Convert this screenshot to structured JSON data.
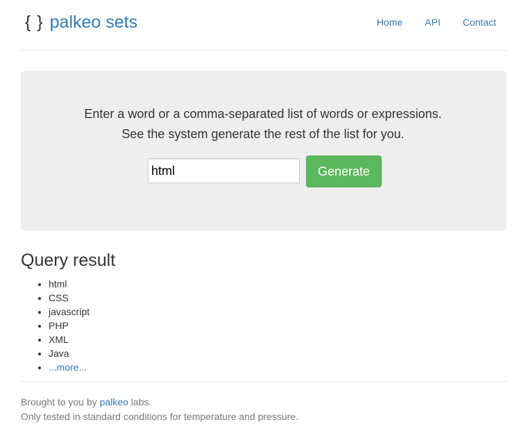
{
  "brand": {
    "icon_text": "{ }",
    "name": "palkeo sets"
  },
  "nav": {
    "items": [
      {
        "label": "Home"
      },
      {
        "label": "API"
      },
      {
        "label": "Contact"
      }
    ]
  },
  "hero": {
    "line1": "Enter a word or a comma-separated list of words or expressions.",
    "line2": "See the system generate the rest of the list for you.",
    "input_value": "html",
    "button_label": "Generate"
  },
  "results": {
    "title": "Query result",
    "items": [
      "html",
      "CSS",
      "javascript",
      "PHP",
      "XML",
      "Java"
    ],
    "more_label": "...more..."
  },
  "footer": {
    "line1_prefix": "Brought to you by ",
    "line1_link": "palkeo",
    "line1_suffix": " labs.",
    "line2": "Only tested in standard conditions for temperature and pressure."
  },
  "colors": {
    "link": "#337ab7",
    "button": "#5cb85c",
    "jumbotron": "#eeeeee",
    "text": "#333333",
    "muted": "#777777"
  }
}
